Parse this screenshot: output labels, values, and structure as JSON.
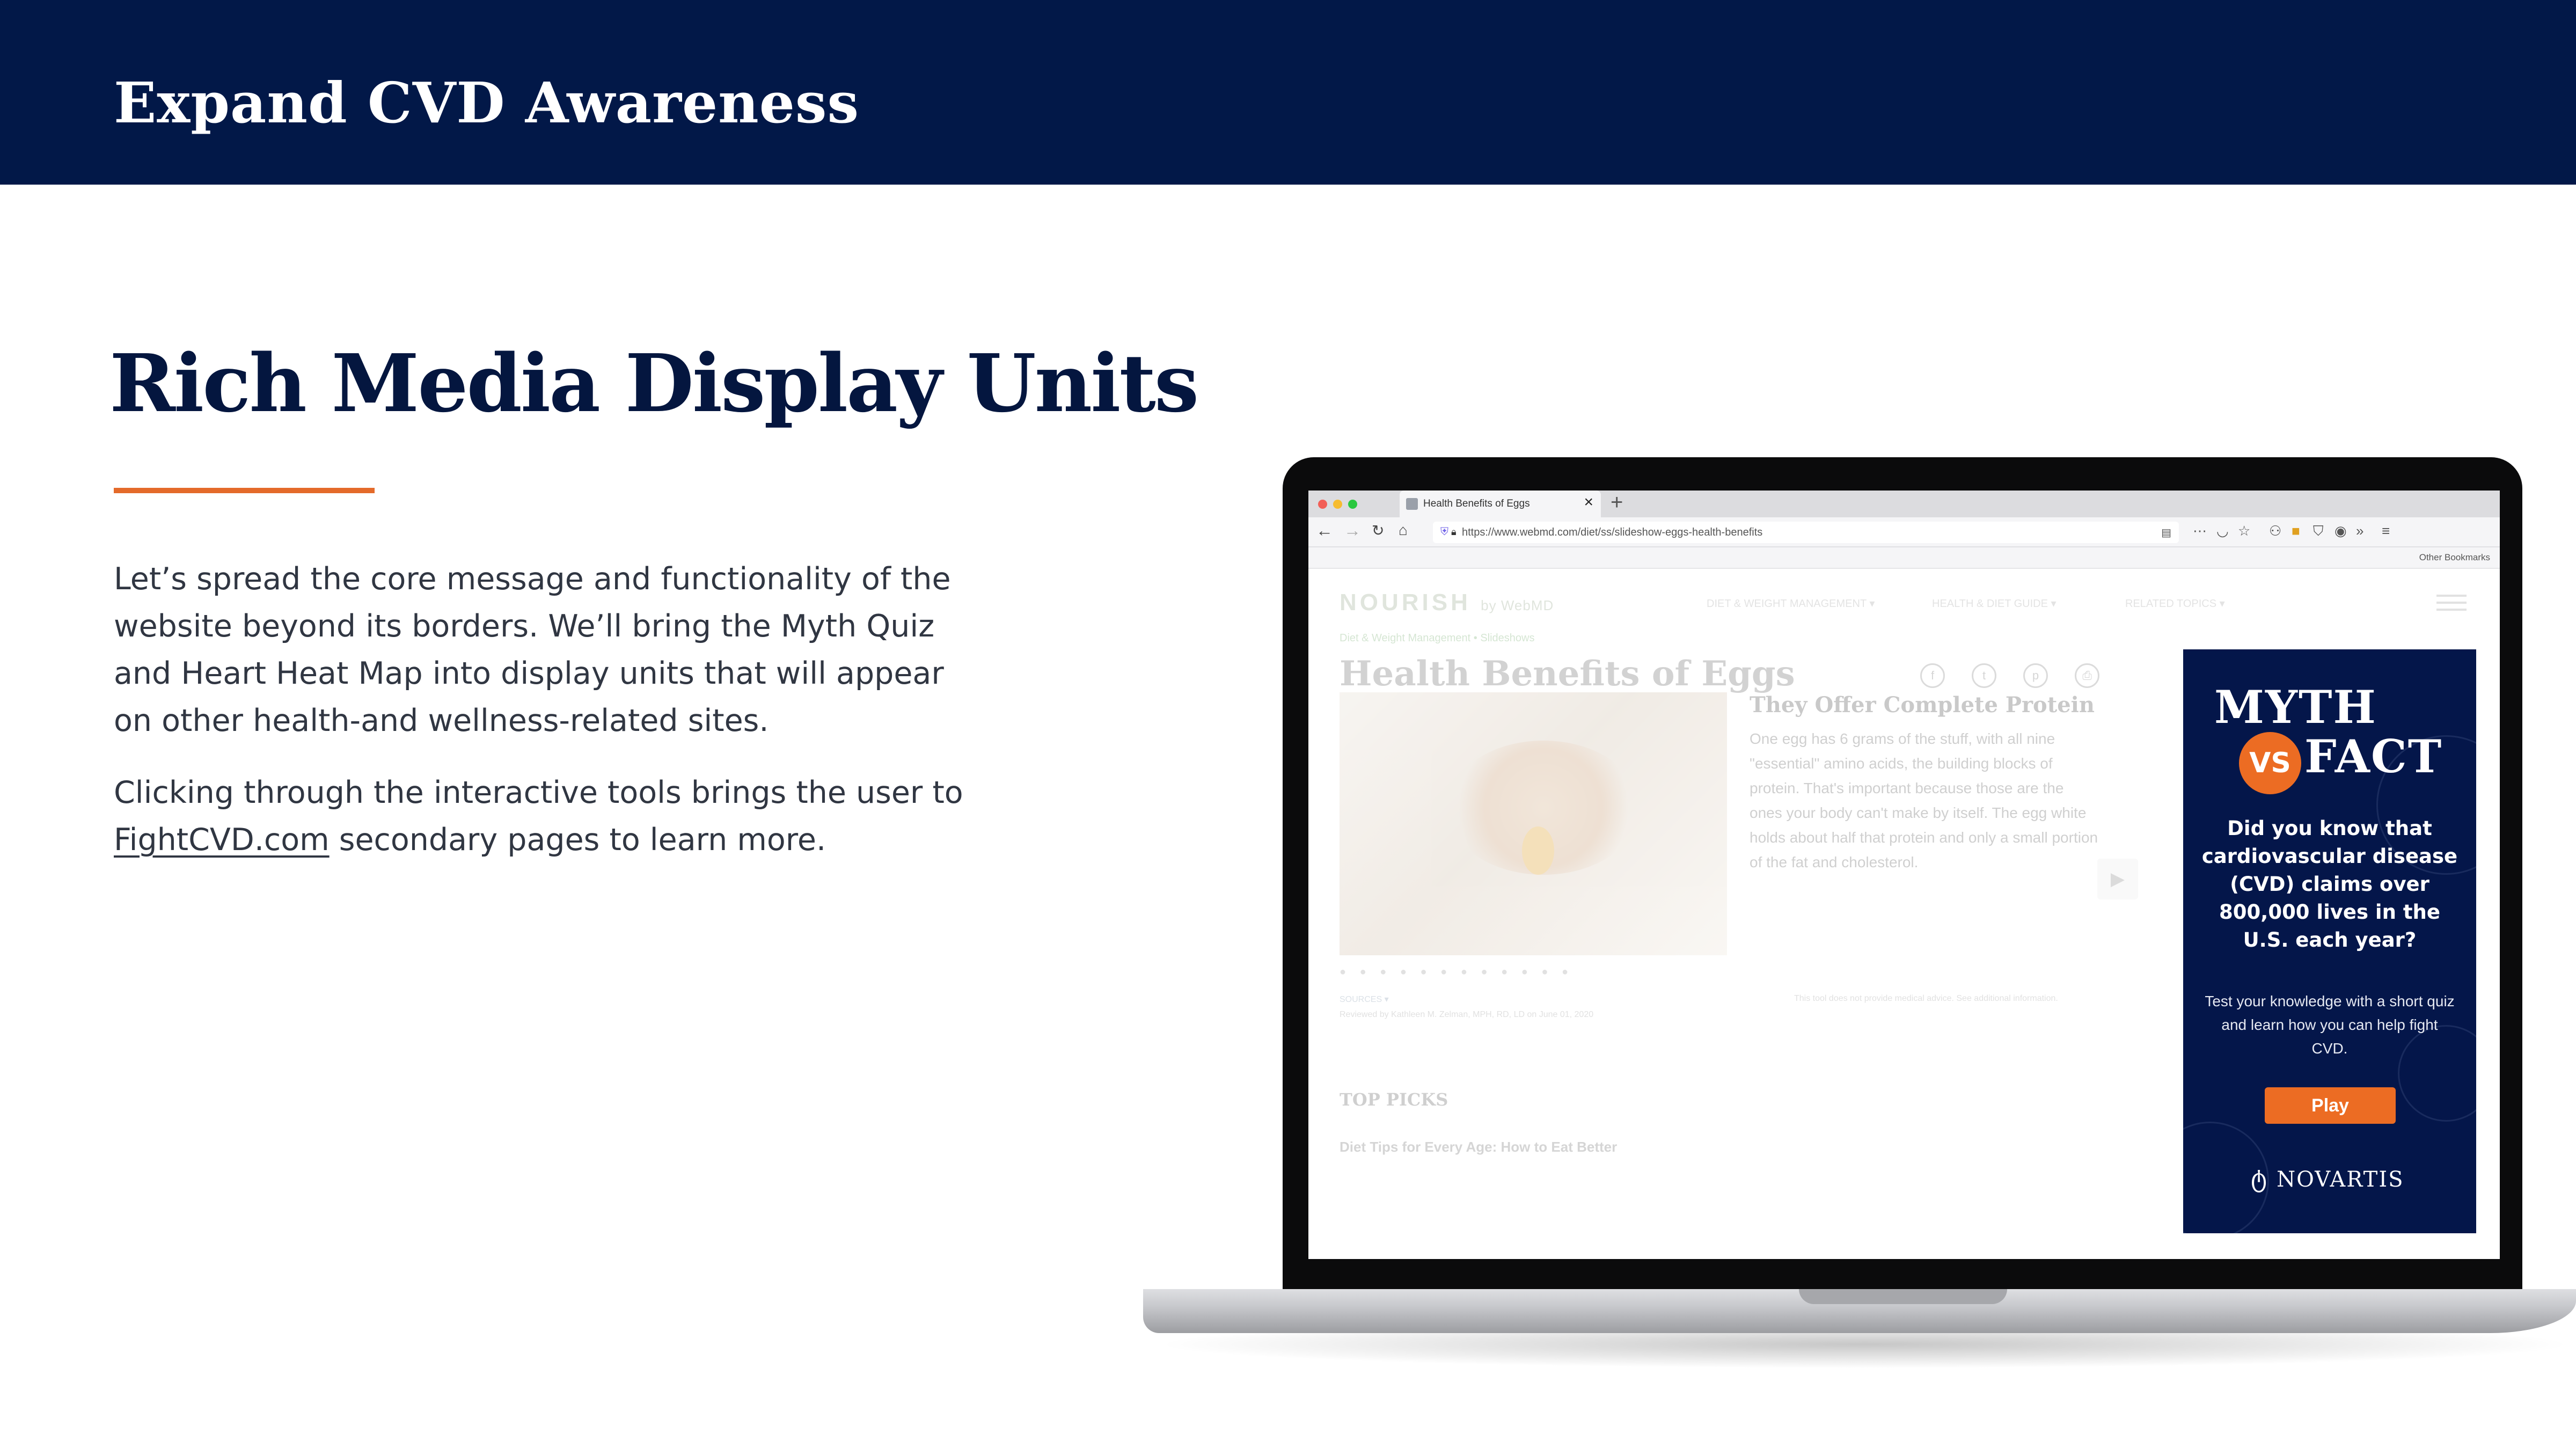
{
  "slide": {
    "header_title": "Expand CVD Awareness",
    "heading": "Rich Media Display Units",
    "paragraph1": "Let’s spread the core message and functionality of the website beyond its borders. We’ll bring the Myth Quiz and Heart Heat Map into display units that will appear on other health-and wellness-related sites.",
    "paragraph2_before": "Clicking through the interactive tools brings the user to ",
    "paragraph2_link": "FightCVD.com",
    "paragraph2_after": " secondary pages to learn more.",
    "colors": {
      "header_bg": "#021848",
      "heading": "#04163f",
      "accent_rule": "#e46a2a"
    }
  },
  "browser": {
    "tab_title": "Health Benefits of Eggs",
    "tab_close_icon": "close-icon",
    "new_tab_icon": "plus-icon",
    "url": "https://www.webmd.com/diet/ss/slideshow-eggs-health-benefits",
    "bookmarks_label": "Other Bookmarks"
  },
  "webpage": {
    "logo": "NOURISH",
    "logo_sub": "by WebMD",
    "nav": [
      "DIET & WEIGHT MANAGEMENT ▾",
      "HEALTH & DIET GUIDE ▾",
      "RELATED TOPICS ▾"
    ],
    "breadcrumb": "Diet & Weight Management   •   Slideshows",
    "title": "Health Benefits of Eggs",
    "subheading": "They Offer Complete Protein",
    "body": "One egg has 6 grams of the stuff, with all nine \"essential\" amino acids, the building blocks of protein. That's important because those are the ones your body can't make by itself. The egg white holds about half that protein and only a small portion of the fat and cholesterol.",
    "sources": "SOURCES ▾",
    "reviewed": "Reviewed by Kathleen M. Zelman, MPH, RD, LD on June 01, 2020",
    "disclaimer": "This tool does not provide medical advice. See additional information.",
    "top_picks": "TOP PICKS",
    "pick_item": "Diet Tips for Every Age: How to Eat Better"
  },
  "ad": {
    "myth": "MYTH",
    "vs": "VS",
    "fact": "FACT",
    "question": "Did you know that cardiovascular disease (CVD) claims over 800,000 lives in the U.S. each year?",
    "cta_text": "Test your knowledge with a short quiz and learn how you can help fight CVD.",
    "play_label": "Play",
    "sponsor": "NOVARTIS",
    "colors": {
      "bg": "#04164a",
      "accent": "#ec6c23"
    }
  }
}
